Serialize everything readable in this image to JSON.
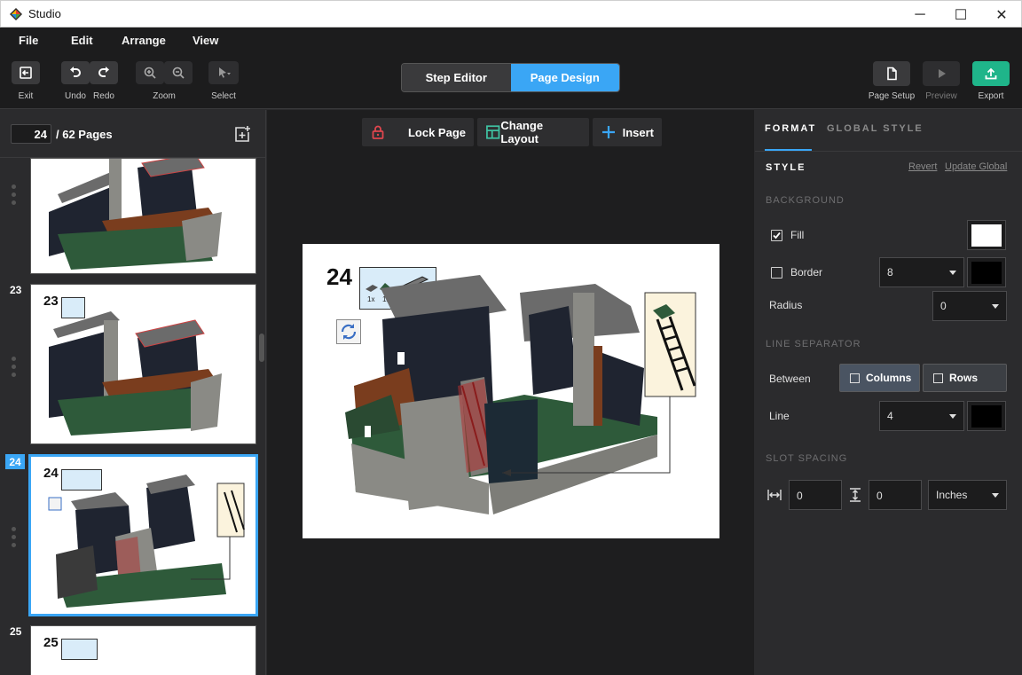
{
  "window": {
    "title": "Studio",
    "controls": {
      "minimize": "─",
      "maximize": "☐",
      "close": "✕"
    }
  },
  "menu": [
    "File",
    "Edit",
    "Arrange",
    "View"
  ],
  "toolbar": {
    "exit": "Exit",
    "undo": "Undo",
    "redo": "Redo",
    "zoom": "Zoom",
    "select": "Select",
    "mode_step_editor": "Step Editor",
    "mode_page_design": "Page Design",
    "active_mode": "Page Design",
    "page_setup": "Page Setup",
    "preview": "Preview",
    "export": "Export"
  },
  "pages_panel": {
    "current_page": "24",
    "total": "/ 62 Pages",
    "thumbnails": [
      {
        "number": "",
        "step": "",
        "selected": false
      },
      {
        "number": "23",
        "step": "23",
        "selected": false
      },
      {
        "number": "24",
        "step": "24",
        "selected": true
      },
      {
        "number": "25",
        "step": "25",
        "selected": false
      }
    ]
  },
  "canvas_toolbar": {
    "lock_page": "Lock Page",
    "change_layout": "Change Layout",
    "insert": "Insert"
  },
  "canvas": {
    "step_number": "24",
    "parts": [
      {
        "qty": "1x"
      },
      {
        "qty": "1x"
      },
      {
        "qty": "1x"
      }
    ]
  },
  "format_panel": {
    "tab_format": "FORMAT",
    "tab_global_style": "GLOBAL STYLE",
    "style_heading": "STYLE",
    "revert": "Revert",
    "update_global": "Update Global",
    "background": {
      "heading": "BACKGROUND",
      "fill_label": "Fill",
      "fill_checked": true,
      "fill_color": "#ffffff",
      "border_label": "Border",
      "border_checked": false,
      "border_width": "8",
      "border_color": "#000000",
      "radius_label": "Radius",
      "radius_value": "0"
    },
    "line_separator": {
      "heading": "LINE SEPARATOR",
      "between_label": "Between",
      "columns_label": "Columns",
      "rows_label": "Rows",
      "line_label": "Line",
      "line_width": "4",
      "line_color": "#000000"
    },
    "slot_spacing": {
      "heading": "SLOT SPACING",
      "horizontal": "0",
      "vertical": "0",
      "unit": "Inches"
    }
  },
  "colors": {
    "accent": "#3aa6f5",
    "export_green": "#1fb58a",
    "lock_red": "#e0464e",
    "layout_teal": "#3fc1a2"
  }
}
